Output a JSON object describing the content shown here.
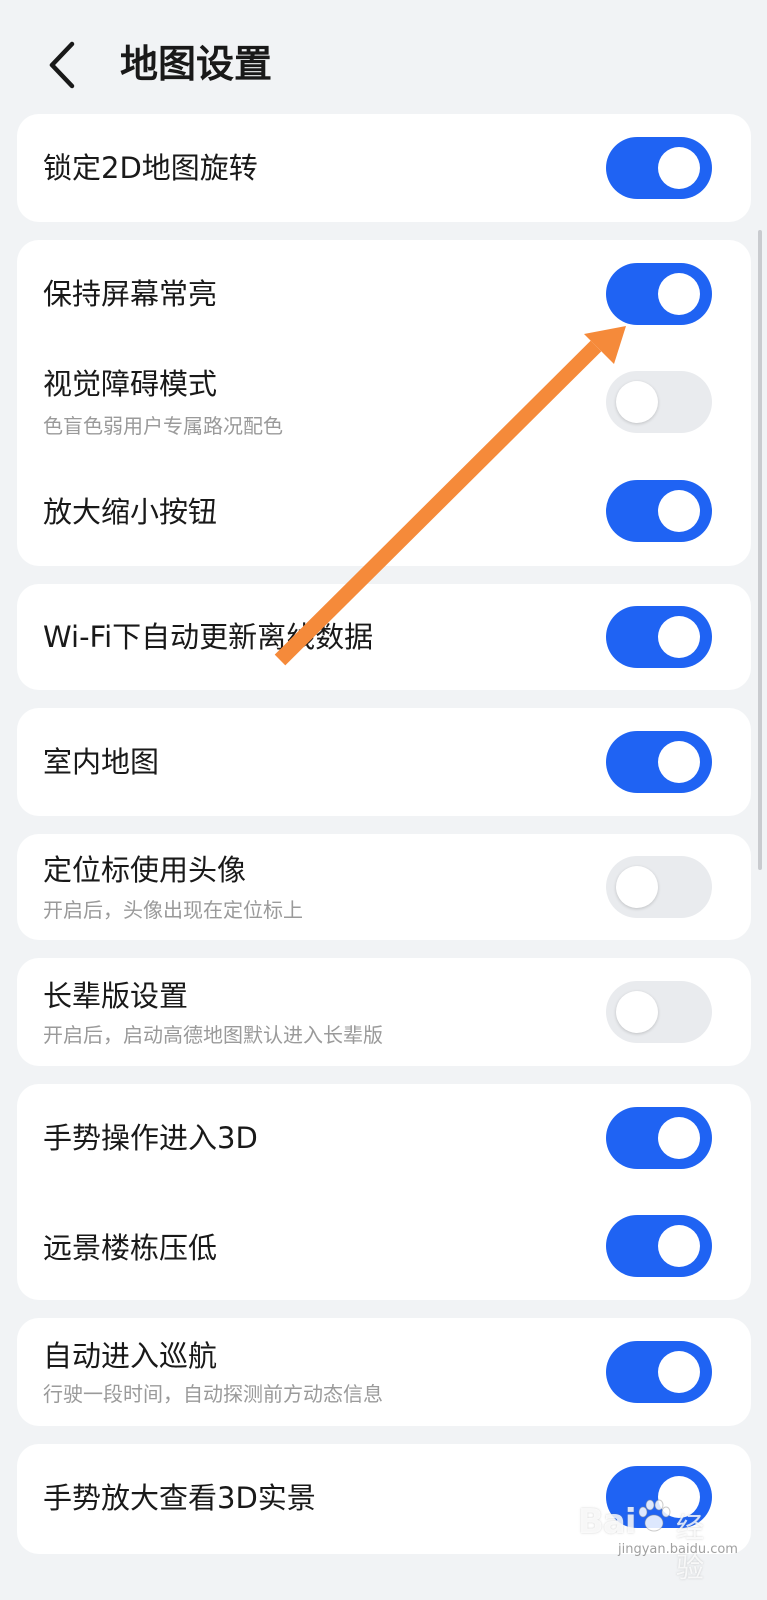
{
  "header": {
    "title": "地图设置"
  },
  "settings": [
    {
      "label": "锁定2D地图旋转",
      "sub": "",
      "on": true
    },
    {
      "label": "保持屏幕常亮",
      "sub": "",
      "on": true
    },
    {
      "label": "视觉障碍模式",
      "sub": "色盲色弱用户专属路况配色",
      "on": false
    },
    {
      "label": "放大缩小按钮",
      "sub": "",
      "on": true
    },
    {
      "label": "Wi-Fi下自动更新离线数据",
      "sub": "",
      "on": true
    },
    {
      "label": "室内地图",
      "sub": "",
      "on": true
    },
    {
      "label": "定位标使用头像",
      "sub": "开启后，头像出现在定位标上",
      "on": false
    },
    {
      "label": "长辈版设置",
      "sub": "开启后，启动高德地图默认进入长辈版",
      "on": false
    },
    {
      "label": "手势操作进入3D",
      "sub": "",
      "on": true
    },
    {
      "label": "远景楼栋压低",
      "sub": "",
      "on": true
    },
    {
      "label": "自动进入巡航",
      "sub": "行驶一段时间，自动探测前方动态信息",
      "on": true
    },
    {
      "label": "手势放大查看3D实景",
      "sub": "",
      "on": true
    }
  ],
  "watermark": {
    "brand": "Bai",
    "zh": "经验",
    "url": "jingyan.baidu.com"
  },
  "colors": {
    "accent": "#1f63f3",
    "arrow": "#f58a3a",
    "background": "#f1f3f5"
  }
}
